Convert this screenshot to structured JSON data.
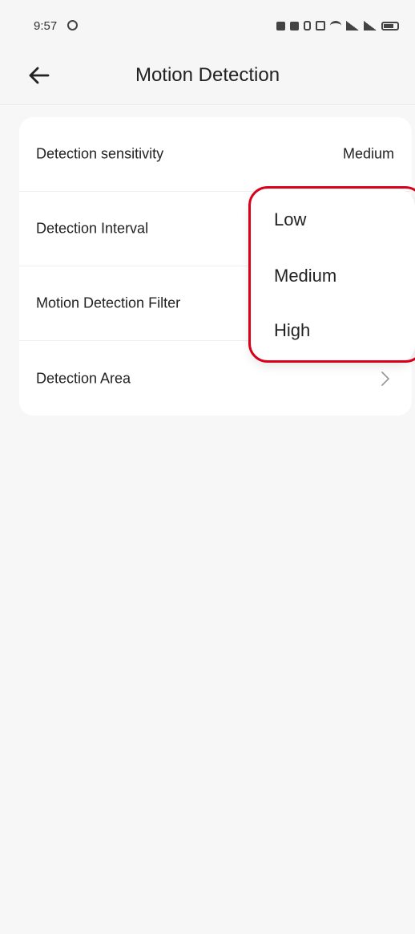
{
  "status_bar": {
    "time": "9:57"
  },
  "header": {
    "title": "Motion Detection",
    "back_icon": "arrow-left-icon"
  },
  "settings": {
    "rows": [
      {
        "label": "Detection sensitivity",
        "value": "Medium"
      },
      {
        "label": "Detection Interval"
      },
      {
        "label": "Motion Detection Filter"
      },
      {
        "label": "Detection Area",
        "icon": "chevron-right-icon"
      }
    ]
  },
  "dropdown": {
    "options": [
      "Low",
      "Medium",
      "High"
    ]
  },
  "colors": {
    "highlight": "#d9001b",
    "background": "#f7f7f7",
    "card": "#ffffff"
  }
}
